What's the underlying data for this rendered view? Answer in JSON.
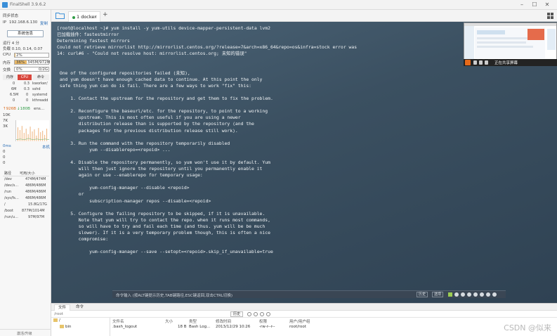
{
  "window": {
    "title": "FinalShell 3.9.6.2"
  },
  "sidebar": {
    "sync_status": "同步状态",
    "ip_label": "IP",
    "ip_value": "192.168.6.130",
    "copy_ip": "复制",
    "system_info_button": "系统信息",
    "uptime": "运行 4 分",
    "load": "负载 0.10, 0.14, 0.07",
    "cpu_label": "CPU",
    "cpu_value": "2%",
    "cpu_level": 0.02,
    "mem_label": "内存",
    "mem_value": "36%",
    "mem_detail": "345M/972M",
    "mem_level": 0.36,
    "swap_label": "交换",
    "swap_value": "0%",
    "swap_detail": "0/2G",
    "swap_level": 0.0,
    "proc_tabs": [
      "内存",
      "CPU",
      "命令"
    ],
    "processes": [
      {
        "mem": "0",
        "cpu": "0.3",
        "cmd": "kworker/"
      },
      {
        "mem": "6M",
        "cpu": "0.3",
        "cmd": "sshd"
      },
      {
        "mem": "6.5M",
        "cpu": "0",
        "cmd": "systemd"
      },
      {
        "mem": "0",
        "cpu": "0",
        "cmd": "kthreadd"
      }
    ],
    "net_up": "↑926B",
    "net_down": "↓180B",
    "net_iface": "ens…",
    "net_scale": [
      "10K",
      "7K",
      "3K"
    ],
    "latency_label": "0ms",
    "latency_host": "本机",
    "latency_values": [
      "0",
      "0",
      "0"
    ],
    "disk_headers": [
      "路径",
      "可用/大小"
    ],
    "disks": [
      {
        "path": "/dev",
        "size": "474M/474M"
      },
      {
        "path": "/dev/s…",
        "size": "486M/486M"
      },
      {
        "path": "/run",
        "size": "486M/486M"
      },
      {
        "path": "/sys/fs…",
        "size": "486M/486M"
      },
      {
        "path": "/",
        "size": "15.8G/17G"
      },
      {
        "path": "/boot",
        "size": "877M/1014M"
      },
      {
        "path": "/run/u…",
        "size": "97M/97M"
      }
    ],
    "footer": "激活/升级"
  },
  "tabs": {
    "active_tab": "1 docker",
    "close": "×",
    "add": "+"
  },
  "terminal": {
    "lines": [
      "[root@localhost ~]# yum install -y yum-utils device-mapper-persistent-data lvm2",
      "已加载插件：fastestmirror",
      "Determining fastest mirrors",
      "Could not retrieve mirrorlist http://mirrorlist.centos.org/?release=7&arch=x86_64&repo=os&infra=stock error was",
      "14: curl#6 - \"Could not resolve host: mirrorlist.centos.org; 未知的错误\"",
      "",
      "",
      " One of the configured repositories failed (未知),",
      " and yum doesn't have enough cached data to continue. At this point the only",
      " safe thing yum can do is fail. There are a few ways to work \"fix\" this:",
      "",
      "     1. Contact the upstream for the repository and get them to fix the problem.",
      "",
      "     2. Reconfigure the baseurl/etc. for the repository, to point to a working",
      "        upstream. This is most often useful if you are using a newer",
      "        distribution release than is supported by the repository (and the",
      "        packages for the previous distribution release still work).",
      "",
      "     3. Run the command with the repository temporarily disabled",
      "            yum --disablerepo=<repoid> ...",
      "",
      "     4. Disable the repository permanently, so yum won't use it by default. Yum",
      "        will then just ignore the repository until you permanently enable it",
      "        again or use --enablerepo for temporary usage:",
      "",
      "            yum-config-manager --disable <repoid>",
      "        or",
      "            subscription-manager repos --disable=<repoid>",
      "",
      "     5. Configure the failing repository to be skipped, if it is unavailable.",
      "        Note that yum will try to contact the repo. when it runs most commands,",
      "        so will have to try and fail each time (and thus. yum will be be much",
      "        slower). If it is a very temporary problem though, this is often a nice",
      "        compromise:",
      "",
      "            yum-config-manager --save --setopt=<repoid>.skip_if_unavailable=true"
    ]
  },
  "share_bar": {
    "label": "正在共享屏幕"
  },
  "command_bar": {
    "hint": "命令输入 (按ALT键提示历史,TAB键路径,ESC键返回,双击CTRL切换)",
    "history_button": "历史",
    "options_button": "选项"
  },
  "file_panel": {
    "tabs": [
      "文件",
      "命令"
    ],
    "path": "/root",
    "history_button": "历史",
    "tree": [
      "/",
      "bin"
    ],
    "headers": [
      "文件名",
      "大小",
      "类型",
      "修改时间",
      "权限",
      "用户/用户组"
    ],
    "row": {
      "name": ".bash_logout",
      "size": "18 B",
      "type": "Bash Log...",
      "modified": "2013/12/29 10:26",
      "perm": "-rw-r--r--",
      "owner": "root/root"
    }
  },
  "watermark": "CSDN @似来"
}
